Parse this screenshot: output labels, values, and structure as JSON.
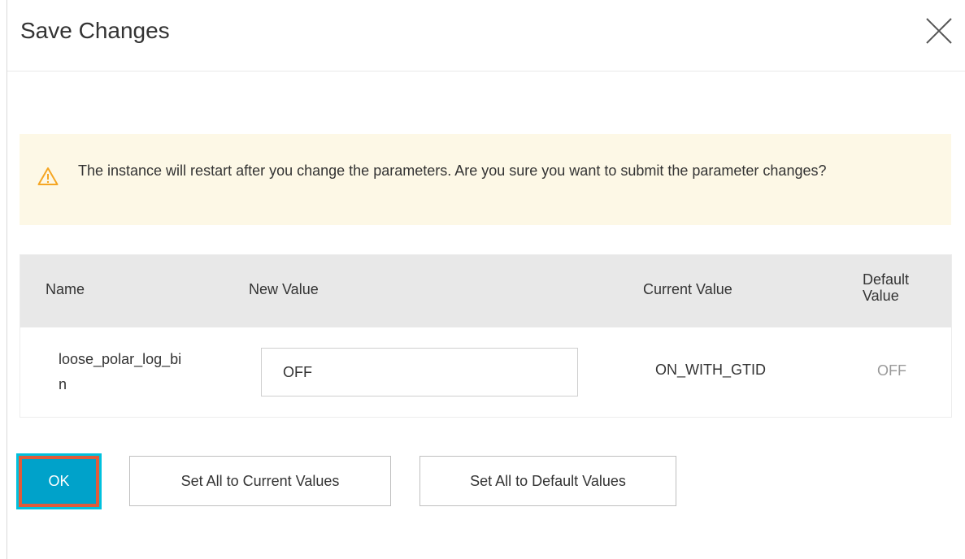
{
  "dialog": {
    "title": "Save Changes",
    "close_icon": "close-icon"
  },
  "alert": {
    "icon": "warning-icon",
    "message": "The instance will restart after you change the parameters. Are you sure you want to submit the parameter changes?",
    "background": "#fdf8e6",
    "icon_color": "#f5a623"
  },
  "table": {
    "headers": {
      "name": "Name",
      "new_value": "New Value",
      "current_value": "Current Value",
      "default_value": "Default Value"
    },
    "rows": [
      {
        "name": "loose_polar_log_bin",
        "new_value": "OFF",
        "current_value": "ON_WITH_GTID",
        "default_value": "OFF"
      }
    ]
  },
  "buttons": {
    "ok": "OK",
    "set_current": "Set All to Current Values",
    "set_default": "Set All to Default Values"
  },
  "colors": {
    "primary": "#00a2ca",
    "highlight_border": "#e05b3a",
    "header_bg": "#e8e8e8"
  }
}
